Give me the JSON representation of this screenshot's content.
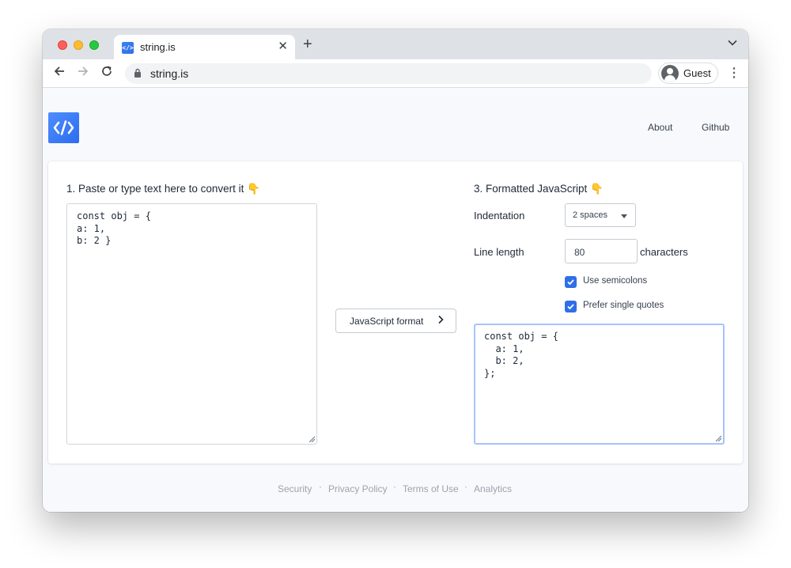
{
  "browser": {
    "tab_title": "string.is",
    "favicon_text": "</>",
    "url": "string.is",
    "profile_name": "Guest"
  },
  "header": {
    "logo_alt": "string.is logo",
    "nav": [
      {
        "label": "About"
      },
      {
        "label": "Github"
      }
    ]
  },
  "input_panel": {
    "title": "1. Paste or type text here to convert it 👇",
    "value": "const obj = {\na: 1,\nb: 2 }"
  },
  "convert_button": {
    "label": "JavaScript format"
  },
  "output_panel": {
    "title": "3. Formatted JavaScript 👇",
    "indentation_label": "Indentation",
    "indentation_value": "2 spaces",
    "line_length_label": "Line length",
    "line_length_value": "80",
    "line_length_unit": "characters",
    "options": [
      {
        "label": "Use semicolons",
        "checked": true
      },
      {
        "label": "Prefer single quotes",
        "checked": true
      }
    ],
    "value": "const obj = {\n  a: 1,\n  b: 2,\n};"
  },
  "footer": {
    "links": [
      {
        "label": "Security"
      },
      {
        "label": "Privacy Policy"
      },
      {
        "label": "Terms of Use"
      },
      {
        "label": "Analytics"
      }
    ],
    "separator": "·"
  },
  "colors": {
    "accent": "#2f6fe8",
    "page_background": "#f8f9fc"
  }
}
